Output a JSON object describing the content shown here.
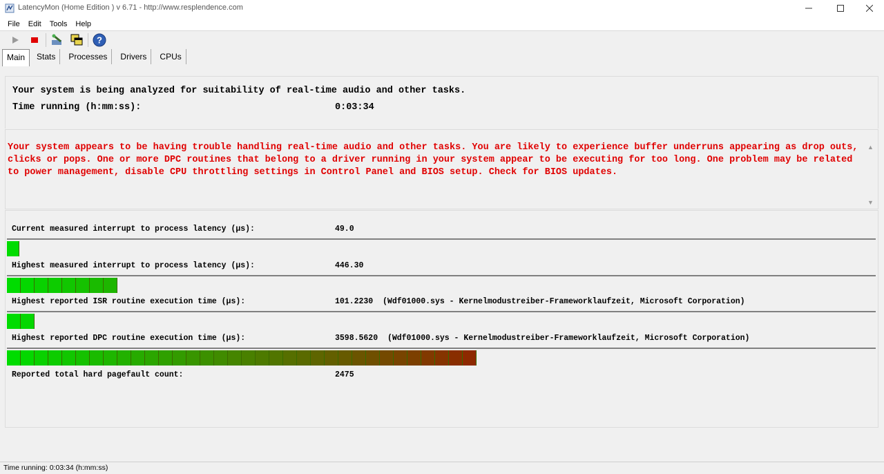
{
  "window": {
    "title": "LatencyMon  (Home Edition )  v 6.71 - http://www.resplendence.com"
  },
  "menu": [
    "File",
    "Edit",
    "Tools",
    "Help"
  ],
  "toolbar": {
    "icons": [
      "play-icon",
      "stop-icon",
      "wizard-icon",
      "windows-icon",
      "help-icon"
    ]
  },
  "tabs": [
    "Main",
    "Stats",
    "Processes",
    "Drivers",
    "CPUs"
  ],
  "status": {
    "headline": "Your system is being analyzed for suitability of real-time audio and other tasks.",
    "time_label": "Time running (h:mm:ss):",
    "time_value": "0:03:34"
  },
  "warning": {
    "text": "Your system appears to be having trouble handling real-time audio and other tasks. You are likely to experience buffer underruns appearing as drop outs, clicks or pops. One or more DPC routines that belong to a driver running in your system appear to be executing for too long. One problem may be related to power management, disable CPU throttling settings in Control Panel and BIOS setup. Check for BIOS updates."
  },
  "metrics": [
    {
      "label": "Current measured interrupt to process latency (µs):",
      "value": "49.0",
      "detail": "",
      "level": 0.014
    },
    {
      "label": "Highest measured interrupt to process latency (µs):",
      "value": "446.30",
      "detail": "",
      "level": 0.134
    },
    {
      "label": "Highest reported ISR routine execution time (µs):",
      "value": "101.2230",
      "detail": "(Wdf01000.sys - Kernelmodustreiber-Frameworklaufzeit, Microsoft Corporation)",
      "level": 0.03
    },
    {
      "label": "Highest reported DPC routine execution time (µs):",
      "value": "3598.5620",
      "detail": "(Wdf01000.sys - Kernelmodustreiber-Frameworklaufzeit, Microsoft Corporation)",
      "level": 0.548
    },
    {
      "label": "Reported total hard pagefault count:",
      "value": "2475",
      "detail": ""
    }
  ],
  "statusbar": {
    "text": "Time running: 0:03:34  (h:mm:ss)"
  }
}
